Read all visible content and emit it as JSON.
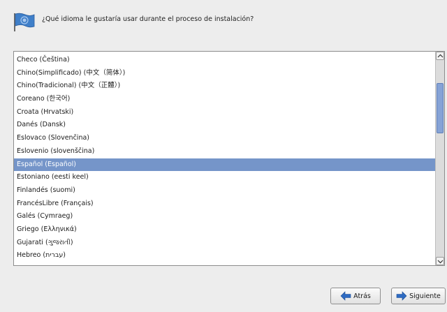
{
  "header": {
    "prompt": "¿Qué idioma le gustaría usar durante el proceso de instalación?",
    "icon": "flag-icon"
  },
  "languages": {
    "selected_index": 8,
    "items": [
      "Checo (Čeština)",
      "Chino(Simplificado) (中文（简体）)",
      "Chino(Tradicional) (中文（正體）)",
      "Coreano (한국어)",
      "Croata (Hrvatski)",
      "Danés (Dansk)",
      "Eslovaco (Slovenčina)",
      "Eslovenio (slovenščina)",
      "Español (Español)",
      "Estoniano (eesti keel)",
      "Finlandés (suomi)",
      "FrancésLibre (Français)",
      "Galés (Cymraeg)",
      "Griego (Ελληνικά)",
      "Gujarati (ગુજરાતી)",
      "Hebreo (עברית)"
    ]
  },
  "buttons": {
    "back_label": "Atrás",
    "next_label": "Siguiente",
    "back_icon": "arrow-left-icon",
    "next_icon": "arrow-right-icon"
  },
  "colors": {
    "selection": "#7595c9",
    "arrow": "#2e6bc2"
  }
}
